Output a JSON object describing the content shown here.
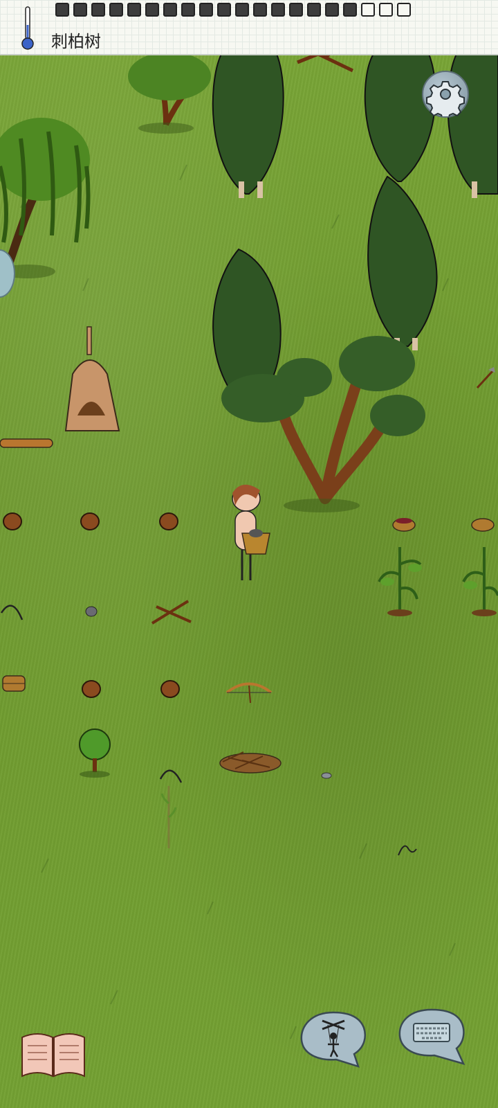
{
  "hud": {
    "hovered_object_label": "刺柏树",
    "food_pips_total": 20,
    "food_pips_filled": 17,
    "thermometer_icon": "thermometer-icon"
  },
  "controls": {
    "settings_icon": "gear-icon",
    "tech_book_icon": "open-book-icon",
    "emote_icon": "puppet-icon",
    "keyboard_icon": "keyboard-icon"
  },
  "colors": {
    "grass": "#6f9a2f",
    "tree_dark": "#2f5524",
    "bark": "#7a3f1a",
    "hud_paper": "#f7f8f2",
    "bubble": "#a9bdc8"
  },
  "world_objects": [
    "juniper-tree",
    "cypress-tree",
    "willow-tree",
    "adobe-kiln",
    "basket",
    "berry-bush",
    "bow",
    "kindling",
    "player-character"
  ]
}
